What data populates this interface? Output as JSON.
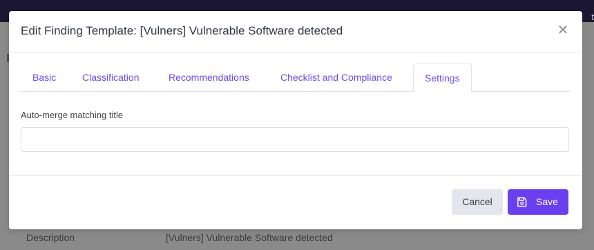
{
  "background": {
    "topbar_peek": "t",
    "description_label": "Description",
    "description_value": "[Vulners] Vulnerable Software detected"
  },
  "modal": {
    "title": "Edit Finding Template: [Vulners] Vulnerable Software detected",
    "close_icon": "close-icon",
    "tabs": [
      {
        "label": "Basic",
        "active": false
      },
      {
        "label": "Classification",
        "active": false
      },
      {
        "label": "Recommendations",
        "active": false
      },
      {
        "label": "Checklist and Compliance",
        "active": false
      },
      {
        "label": "Settings",
        "active": true
      }
    ],
    "field": {
      "label": "Auto-merge matching title",
      "value": "",
      "placeholder": ""
    },
    "footer": {
      "cancel_label": "Cancel",
      "save_label": "Save",
      "save_icon": "save-icon"
    }
  },
  "colors": {
    "accent": "#6a3ff0",
    "tab_text": "#6a4bf0",
    "topbar": "#1b1733"
  }
}
